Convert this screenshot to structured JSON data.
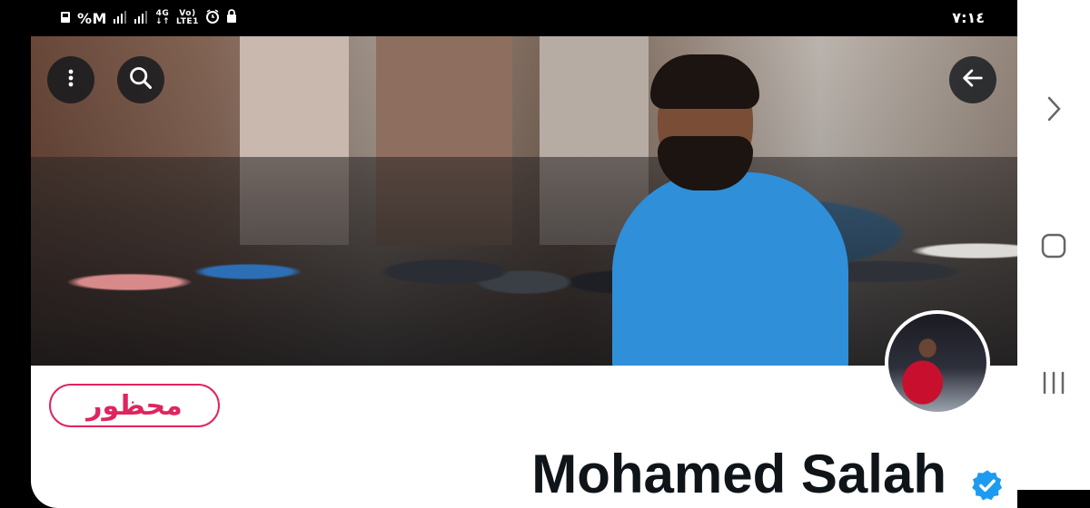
{
  "status_bar": {
    "left_indicators": "%M",
    "network_top": "4G",
    "network_bottom": "↓↑",
    "volte_top": "Vo)",
    "volte_bottom": "LTE1",
    "time": "٧:١٤"
  },
  "header": {
    "more_icon": "more-vertical-icon",
    "search_icon": "search-icon",
    "back_icon": "arrow-left-icon"
  },
  "profile": {
    "blocked_label": "محظور",
    "display_name": "Mohamed Salah",
    "verified_icon": "verified-badge-icon"
  },
  "nav_bar": {
    "forward_icon": "chevron-right-icon",
    "home_icon": "home-square-icon",
    "recents_icon": "recents-icon"
  },
  "colors": {
    "accent": "#1d9bf0",
    "blocked": "#e0245e",
    "text": "#0f1419"
  }
}
